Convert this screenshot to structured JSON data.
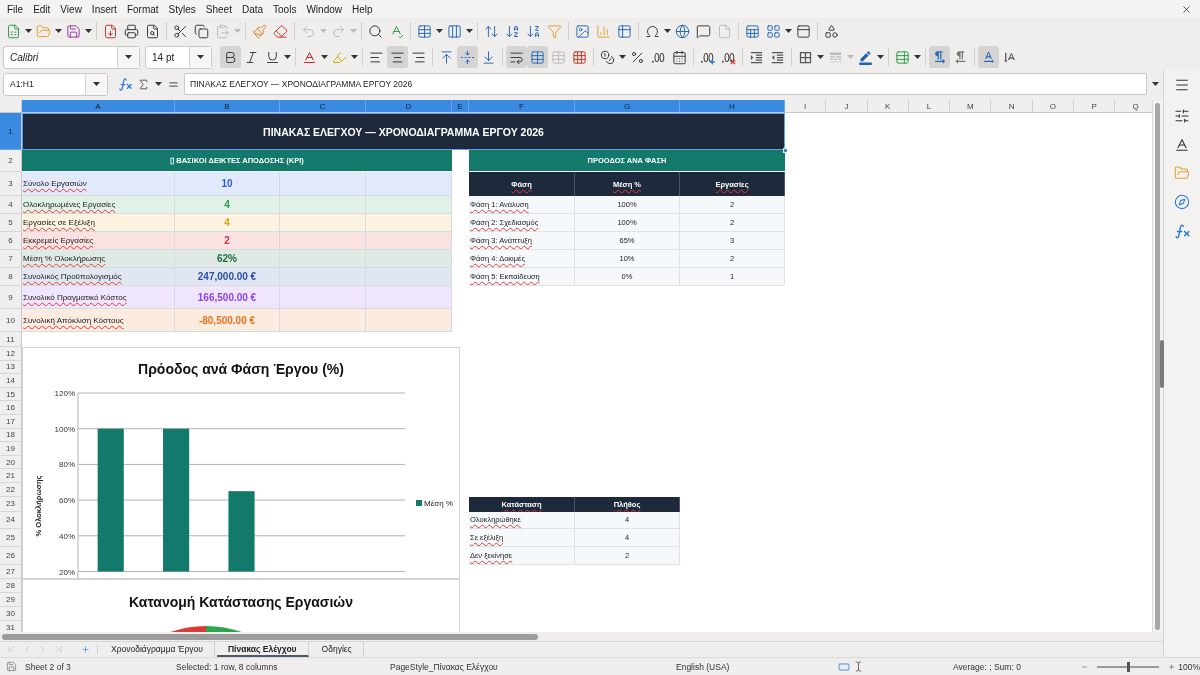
{
  "menu_bar": {
    "items": [
      "File",
      "Edit",
      "View",
      "Insert",
      "Format",
      "Styles",
      "Sheet",
      "Data",
      "Tools",
      "Window",
      "Help"
    ]
  },
  "standard_toolbar": {
    "paste_disabled": true,
    "undo_disabled": true,
    "redo_disabled": true,
    "header_footer_disabled": true
  },
  "formatting_toolbar": {
    "font_name": "Calibri",
    "font_size": "14 pt",
    "bold": true,
    "italic": false,
    "underline": false,
    "align_left": false,
    "align_center": true,
    "align_right": false,
    "align_top": false,
    "align_middle": true,
    "align_bottom": false,
    "wrap_text": true,
    "merge_and_center": true,
    "merge_disabled": true,
    "border_style_disabled": true,
    "left_to_right": true,
    "right_to_left": false,
    "horizontal_text": true,
    "vertical_text": false
  },
  "formula_bar": {
    "name_box": "A1:H1",
    "content": "ΠΙΝΑΚΑΣ ΕΛΕΓΧΟΥ — ΧΡΟΝΟΔΙΑΓΡΑΜΜΑ ΕΡΓΟΥ 2026"
  },
  "sheet": {
    "autospell": true,
    "columns": [
      {
        "label": "A",
        "selected": true
      },
      {
        "label": "B",
        "selected": true
      },
      {
        "label": "C",
        "selected": true
      },
      {
        "label": "D",
        "selected": true
      },
      {
        "label": "E",
        "selected": true
      },
      {
        "label": "F",
        "selected": true
      },
      {
        "label": "G",
        "selected": true
      },
      {
        "label": "H",
        "selected": true
      },
      {
        "label": "I",
        "selected": false
      },
      {
        "label": "J",
        "selected": false
      },
      {
        "label": "K",
        "selected": false
      },
      {
        "label": "L",
        "selected": false
      },
      {
        "label": "M",
        "selected": false
      },
      {
        "label": "N",
        "selected": false
      },
      {
        "label": "O",
        "selected": false
      },
      {
        "label": "P",
        "selected": false
      },
      {
        "label": "Q",
        "selected": false
      }
    ],
    "rows": [
      {
        "label": "1",
        "selected": true
      },
      {
        "label": "2",
        "selected": false
      },
      {
        "label": "3",
        "selected": false
      },
      {
        "label": "4",
        "selected": false
      },
      {
        "label": "5",
        "selected": false
      },
      {
        "label": "6",
        "selected": false
      },
      {
        "label": "7",
        "selected": false
      },
      {
        "label": "8",
        "selected": false
      },
      {
        "label": "9",
        "selected": false
      },
      {
        "label": "10",
        "selected": false
      },
      {
        "label": "11",
        "selected": false
      },
      {
        "label": "12",
        "selected": false
      },
      {
        "label": "13",
        "selected": false
      },
      {
        "label": "14",
        "selected": false
      },
      {
        "label": "15",
        "selected": false
      },
      {
        "label": "16",
        "selected": false
      },
      {
        "label": "17",
        "selected": false
      },
      {
        "label": "18",
        "selected": false
      },
      {
        "label": "19",
        "selected": false
      },
      {
        "label": "20",
        "selected": false
      },
      {
        "label": "21",
        "selected": false
      },
      {
        "label": "22",
        "selected": false
      },
      {
        "label": "23",
        "selected": false
      },
      {
        "label": "24",
        "selected": false
      },
      {
        "label": "25",
        "selected": false
      },
      {
        "label": "26",
        "selected": false
      },
      {
        "label": "27",
        "selected": false
      },
      {
        "label": "28",
        "selected": false
      },
      {
        "label": "29",
        "selected": false
      },
      {
        "label": "30",
        "selected": false
      },
      {
        "label": "31",
        "selected": false
      }
    ],
    "title_cell": {
      "text": "ΠΙΝΑΚΑΣ ΕΛΕΓΧΟΥ — ΧΡΟΝΟΔΙΑΓΡΑΜΜΑ ΕΡΓΟΥ 2026",
      "selected": true
    },
    "kpi_panel": {
      "heading": "▯ ΒΑΣΙΚΟΙ ΔΕΙΚΤΕΣ ΑΠΟΔΟΣΗΣ (KPI)",
      "rows": [
        {
          "label": "Σύνολο Εργασιών",
          "value": "10",
          "color": "#2b5fd9"
        },
        {
          "label": "Ολοκληρωμένες Εργασίες",
          "value": "4",
          "color": "#2a9d4a"
        },
        {
          "label": "Εργασίες σε Εξέλιξη",
          "value": "4",
          "color": "#e0a21a"
        },
        {
          "label": "Εκκρεμείς Εργασίες",
          "value": "2",
          "color": "#dc2f2f"
        },
        {
          "label": "Μέση % Ολοκλήρωσης",
          "value": "62%",
          "color": "#1d6b3c"
        },
        {
          "label": "Συνολικός Προϋπολογισμός",
          "value": "247,000.00 €",
          "color": "#2c4ea8"
        },
        {
          "label": "Συνολικό Πραγματικό Κόστος",
          "value": "166,500.00 €",
          "color": "#8e44e6"
        },
        {
          "label": "Συνολική Απόκλιση Κόστους",
          "value": "-80,500.00 €",
          "color": "#e8721c"
        }
      ]
    },
    "phase_table": {
      "heading": "ΠΡΟΟΔΟΣ ΑΝΑ ΦΑΣΗ",
      "columns": [
        "Φάση",
        "Μέση %",
        "Εργασίες"
      ],
      "rows": [
        {
          "phase": "Φάση 1: Ανάλυση",
          "average": "100%",
          "tasks": "2"
        },
        {
          "phase": "Φάση 2: Σχεδιασμός",
          "average": "100%",
          "tasks": "2"
        },
        {
          "phase": "Φάση 3: Ανάπτυξη",
          "average": "65%",
          "tasks": "3"
        },
        {
          "phase": "Φάση 4: Δοκιμές",
          "average": "10%",
          "tasks": "2"
        },
        {
          "phase": "Φάση 5: Εκπαίδευση",
          "average": "0%",
          "tasks": "1"
        }
      ]
    },
    "progress_chart": {
      "chart_data": {
        "type": "bar",
        "title": "Πρόοδος ανά Φάση Έργου (%)",
        "ylabel": "% Ολοκλήρωσης",
        "series": [
          {
            "name": "Μέση %",
            "color": "#137a6b",
            "values": [
              100,
              100,
              65
            ]
          }
        ],
        "ylim": [
          20,
          120
        ],
        "yticks": [
          {
            "value": 20,
            "label": "20%"
          },
          {
            "value": 40,
            "label": "40%"
          },
          {
            "value": 60,
            "label": "60%"
          },
          {
            "value": 80,
            "label": "80%"
          },
          {
            "value": 100,
            "label": "100%"
          },
          {
            "value": 120,
            "label": "120%"
          }
        ],
        "grid": true
      }
    },
    "status_table": {
      "columns": [
        "Κατάσταση",
        "Πλήθος"
      ],
      "rows": [
        {
          "status": "Ολοκληρώθηκε",
          "count": "4"
        },
        {
          "status": "Σε εξέλιξη",
          "count": "4"
        },
        {
          "status": "Δεν ξεκίνησε",
          "count": "2"
        }
      ]
    },
    "status_chart": {
      "title": "Κατανομή Κατάστασης Εργασιών"
    }
  },
  "sheet_tabs": [
    {
      "label": "Χρονοδιάγραμμα Έργου",
      "selected": false
    },
    {
      "label": "Πίνακας Ελέγχου",
      "selected": true
    },
    {
      "label": "Οδηγίες",
      "selected": false
    }
  ],
  "status_bar": {
    "sheet_position": "Sheet 2 of 3",
    "selection": "Selected: 1 row, 8 columns",
    "page_style": "PageStyle_Πίνακας Ελέγχου",
    "language": "English (USA)",
    "summary": "Average: ; Sum: 0",
    "zoom_slider": {
      "level": 0.5
    },
    "zoom": "100%"
  }
}
